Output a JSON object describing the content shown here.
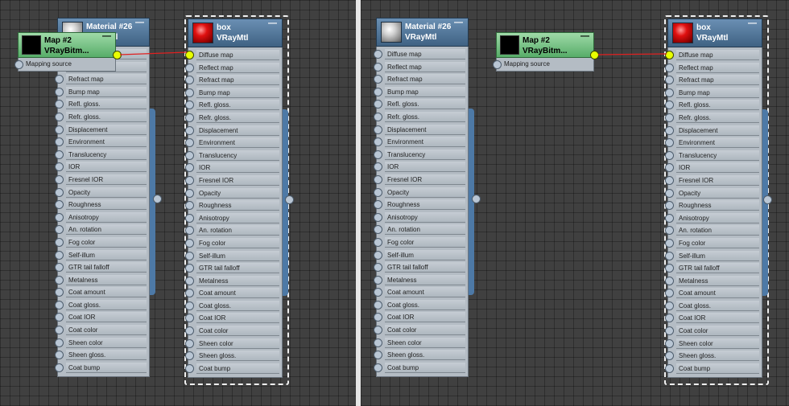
{
  "panels": [
    {
      "material_node": {
        "name": "Material #26",
        "type": "VRayMtl",
        "swatch": "gray"
      },
      "map_node": {
        "name": "Map #2",
        "type": "VRayBitm...",
        "output_slot": "Mapping source"
      },
      "box_node": {
        "name": "box",
        "type": "VRayMtl",
        "swatch": "red"
      },
      "wire_color": "#e02020"
    },
    {
      "material_node": {
        "name": "Material #26",
        "type": "VRayMtl",
        "swatch": "gray"
      },
      "map_node": {
        "name": "Map #2",
        "type": "VRayBitm...",
        "output_slot": "Mapping source"
      },
      "box_node": {
        "name": "box",
        "type": "VRayMtl",
        "swatch": "red"
      },
      "wire_color": "#e02020"
    }
  ],
  "slots": [
    "Diffuse map",
    "Reflect map",
    "Refract map",
    "Bump map",
    "Refl. gloss.",
    "Refr. gloss.",
    "Displacement",
    "Environment",
    "Translucency",
    "IOR",
    "Fresnel IOR",
    "Opacity",
    "Roughness",
    "Anisotropy",
    "An. rotation",
    "Fog color",
    "Self-illum",
    "GTR tail falloff",
    "Metalness",
    "Coat amount",
    "Coat gloss.",
    "Coat IOR",
    "Coat color",
    "Sheen color",
    "Sheen gloss.",
    "Coat bump"
  ],
  "minimize_glyph": "—",
  "colors": {
    "background": "#404040",
    "header_blue": "#4f7396",
    "map_green": "#6ac07a",
    "active_port": "#e8ff00"
  }
}
